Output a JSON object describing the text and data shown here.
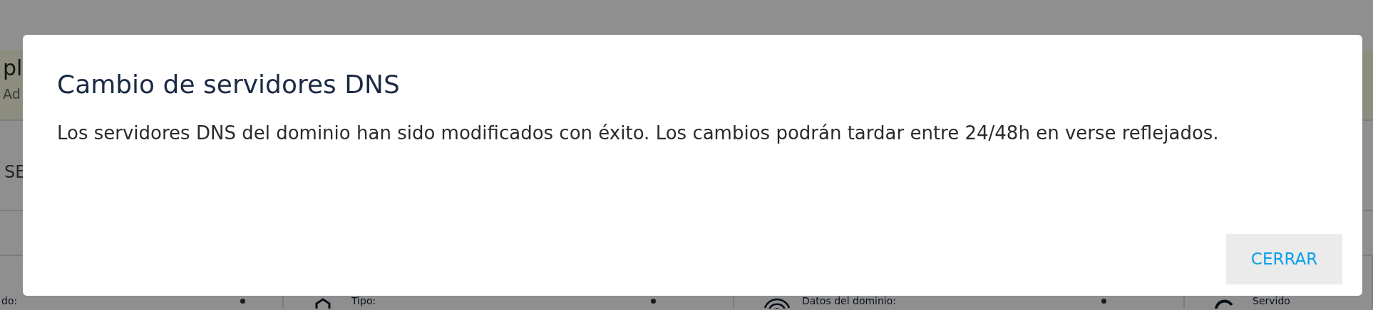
{
  "background": {
    "header": {
      "title": "pl",
      "subtitle": "Ad"
    },
    "tab": {
      "label": "SE"
    },
    "cards": [
      {
        "label": "do:"
      },
      {
        "label": "Tipo:"
      },
      {
        "label": "Datos del dominio:"
      },
      {
        "label": "Servido"
      }
    ]
  },
  "dialog": {
    "title": "Cambio de servidores DNS",
    "message": "Los servidores DNS del dominio han sido modificados con éxito. Los cambios podrán tardar entre 24/48h en verse reflejados.",
    "buttons": [
      {
        "label": "CERRAR"
      }
    ]
  }
}
